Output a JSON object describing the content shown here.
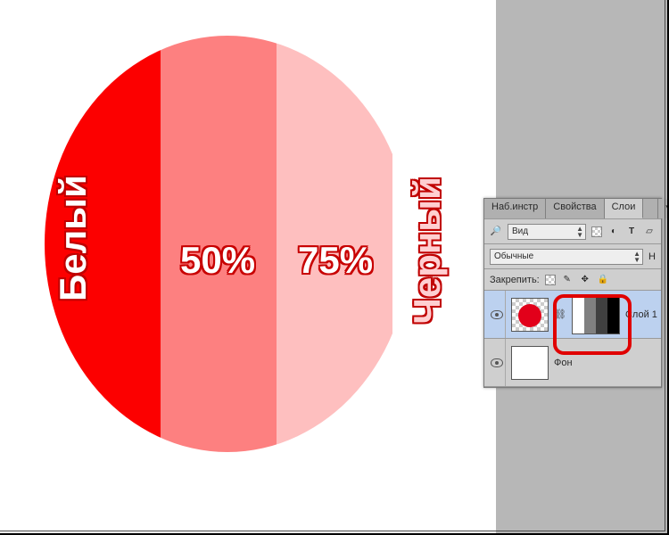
{
  "canvas": {
    "labels": {
      "left": "Белый",
      "right": "Черный",
      "pct50": "50%",
      "pct75": "75%"
    },
    "segments": {
      "a_color": "#fc0000",
      "b_color": "#fd8080",
      "c_color": "#febfbf"
    }
  },
  "panels": {
    "tabs": {
      "presets": "Наб.инстр",
      "props": "Свойства",
      "layers": "Слои"
    },
    "kind_row": {
      "icon_label": "Вид"
    },
    "blend_select": "Обычные",
    "blend_right": "Н",
    "lock_label": "Закрепить:",
    "layers": [
      {
        "name": "Слой 1",
        "selected": true
      },
      {
        "name": "Фон",
        "selected": false
      }
    ]
  }
}
